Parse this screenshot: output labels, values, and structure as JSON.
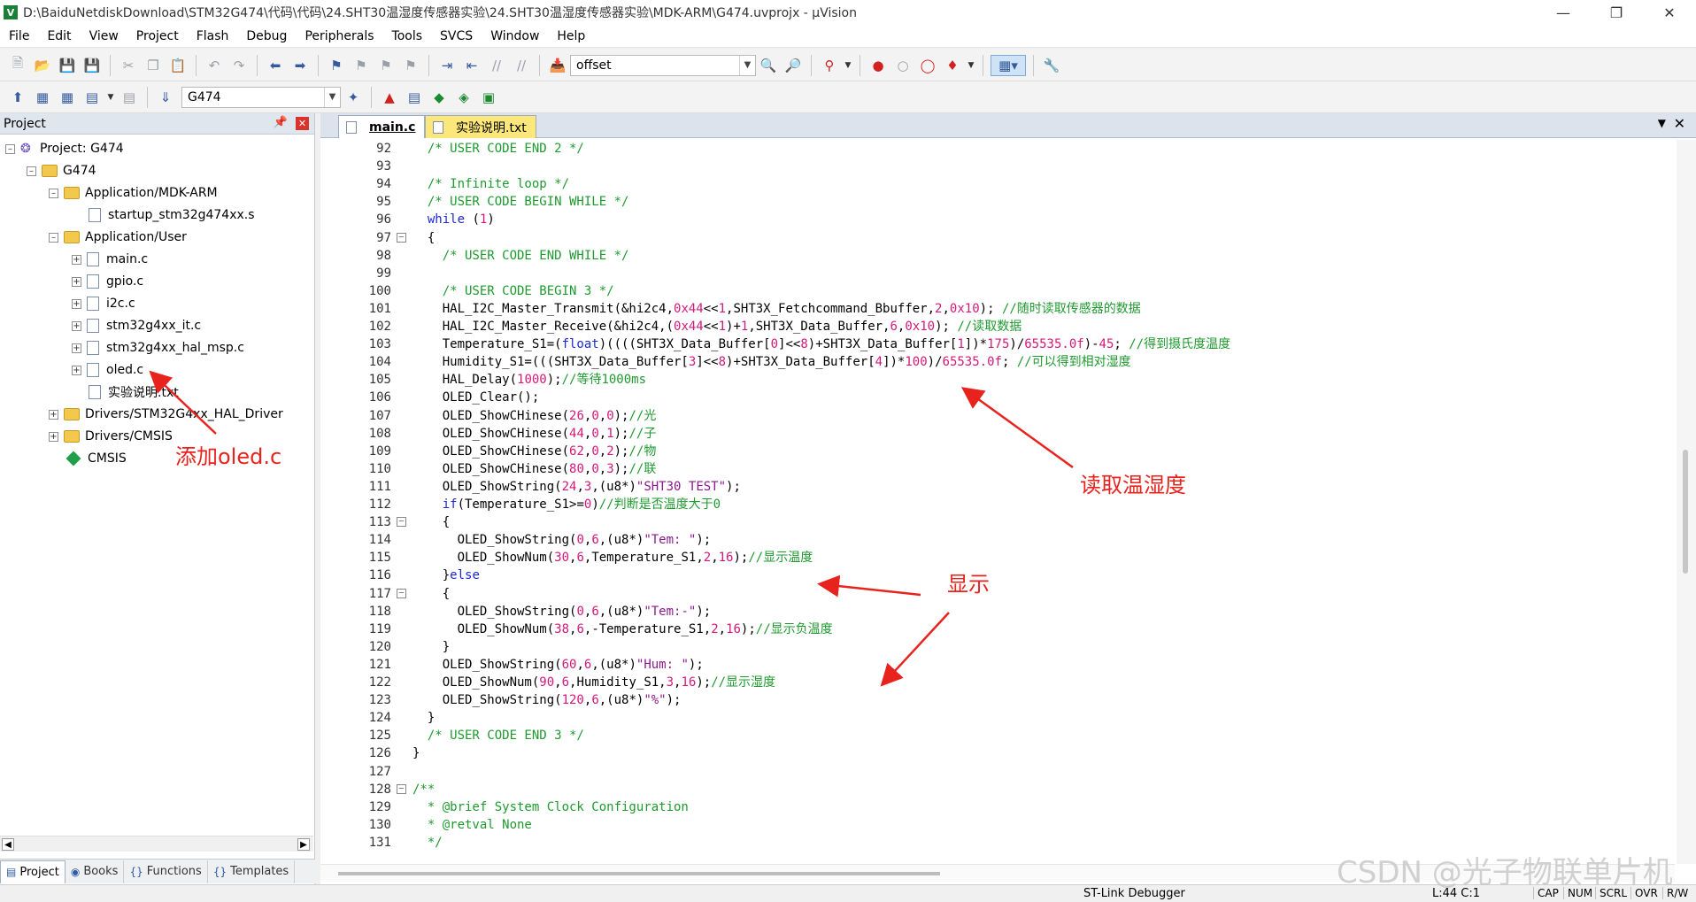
{
  "window": {
    "title": "D:\\BaiduNetdiskDownload\\STM32G474\\代码\\代码\\24.SHT30温湿度传感器实验\\24.SHT30温湿度传感器实验\\MDK-ARM\\G474.uvprojx - µVision"
  },
  "menu": [
    "File",
    "Edit",
    "View",
    "Project",
    "Flash",
    "Debug",
    "Peripherals",
    "Tools",
    "SVCS",
    "Window",
    "Help"
  ],
  "toolbar": {
    "find_value": "offset",
    "target_value": "G474"
  },
  "project": {
    "header": "Project",
    "tree": [
      {
        "label": "Project: G474"
      },
      {
        "label": "G474"
      },
      {
        "label": "Application/MDK-ARM"
      },
      {
        "label": "startup_stm32g474xx.s"
      },
      {
        "label": "Application/User"
      },
      {
        "label": "main.c"
      },
      {
        "label": "gpio.c"
      },
      {
        "label": "i2c.c"
      },
      {
        "label": "stm32g4xx_it.c"
      },
      {
        "label": "stm32g4xx_hal_msp.c"
      },
      {
        "label": "oled.c"
      },
      {
        "label": "实验说明.txt"
      },
      {
        "label": "Drivers/STM32G4xx_HAL_Driver"
      },
      {
        "label": "Drivers/CMSIS"
      },
      {
        "label": "CMSIS"
      }
    ],
    "tabs": [
      "Project",
      "Books",
      "Functions",
      "Templates"
    ]
  },
  "editor": {
    "tabs": [
      "main.c",
      "实验说明.txt"
    ],
    "lines": [
      {
        "n": "92",
        "code": "  /* USER CODE END 2 */"
      },
      {
        "n": "93",
        "code": ""
      },
      {
        "n": "94",
        "code": "  /* Infinite loop */"
      },
      {
        "n": "95",
        "code": "  /* USER CODE BEGIN WHILE */"
      },
      {
        "n": "96",
        "code": "  while (1)"
      },
      {
        "n": "97",
        "code": "  {"
      },
      {
        "n": "98",
        "code": "    /* USER CODE END WHILE */"
      },
      {
        "n": "99",
        "code": ""
      },
      {
        "n": "100",
        "code": "    /* USER CODE BEGIN 3 */"
      },
      {
        "n": "101",
        "code": "    HAL_I2C_Master_Transmit(&hi2c4,0x44<<1,SHT3X_Fetchcommand_Bbuffer,2,0x10); //随时读取传感器的数据"
      },
      {
        "n": "102",
        "code": "    HAL_I2C_Master_Receive(&hi2c4,(0x44<<1)+1,SHT3X_Data_Buffer,6,0x10); //读取数据"
      },
      {
        "n": "103",
        "code": "    Temperature_S1=(float)((((SHT3X_Data_Buffer[0]<<8)+SHT3X_Data_Buffer[1])*175)/65535.0f)-45; //得到摄氏度温度"
      },
      {
        "n": "104",
        "code": "    Humidity_S1=(((SHT3X_Data_Buffer[3]<<8)+SHT3X_Data_Buffer[4])*100)/65535.0f; //可以得到相对湿度"
      },
      {
        "n": "105",
        "code": "    HAL_Delay(1000);//等待1000ms"
      },
      {
        "n": "106",
        "code": "    OLED_Clear();"
      },
      {
        "n": "107",
        "code": "    OLED_ShowCHinese(26,0,0);//光"
      },
      {
        "n": "108",
        "code": "    OLED_ShowCHinese(44,0,1);//子"
      },
      {
        "n": "109",
        "code": "    OLED_ShowCHinese(62,0,2);//物"
      },
      {
        "n": "110",
        "code": "    OLED_ShowCHinese(80,0,3);//联"
      },
      {
        "n": "111",
        "code": "    OLED_ShowString(24,3,(u8*)\"SHT30 TEST\");"
      },
      {
        "n": "112",
        "code": "    if(Temperature_S1>=0)//判断是否温度大于0"
      },
      {
        "n": "113",
        "code": "    {"
      },
      {
        "n": "114",
        "code": "      OLED_ShowString(0,6,(u8*)\"Tem: \");"
      },
      {
        "n": "115",
        "code": "      OLED_ShowNum(30,6,Temperature_S1,2,16);//显示温度"
      },
      {
        "n": "116",
        "code": "    }else"
      },
      {
        "n": "117",
        "code": "    {"
      },
      {
        "n": "118",
        "code": "      OLED_ShowString(0,6,(u8*)\"Tem:-\");"
      },
      {
        "n": "119",
        "code": "      OLED_ShowNum(38,6,-Temperature_S1,2,16);//显示负温度"
      },
      {
        "n": "120",
        "code": "    }"
      },
      {
        "n": "121",
        "code": "    OLED_ShowString(60,6,(u8*)\"Hum: \");"
      },
      {
        "n": "122",
        "code": "    OLED_ShowNum(90,6,Humidity_S1,3,16);//显示湿度"
      },
      {
        "n": "123",
        "code": "    OLED_ShowString(120,6,(u8*)\"%\");"
      },
      {
        "n": "124",
        "code": "  }"
      },
      {
        "n": "125",
        "code": "  /* USER CODE END 3 */"
      },
      {
        "n": "126",
        "code": "}"
      },
      {
        "n": "127",
        "code": ""
      },
      {
        "n": "128",
        "code": "/**"
      },
      {
        "n": "129",
        "code": "  * @brief System Clock Configuration"
      },
      {
        "n": "130",
        "code": "  * @retval None"
      },
      {
        "n": "131",
        "code": "  */"
      }
    ]
  },
  "status": {
    "debugger": "ST-Link Debugger",
    "position": "L:44 C:1",
    "caps": "CAP",
    "num": "NUM",
    "scrl": "SCRL",
    "ovr": "OVR",
    "rw": "R/W"
  },
  "annotations": {
    "add_oled": "添加oled.c",
    "read": "读取温湿度",
    "display": "显示"
  },
  "watermark": "CSDN @光子物联单片机",
  "colors": {
    "comment": "#1f9a2f",
    "keyword": "#1a28d6",
    "number": "#d4197a",
    "string": "#8a1a8c",
    "annotation": "#e8231e"
  }
}
